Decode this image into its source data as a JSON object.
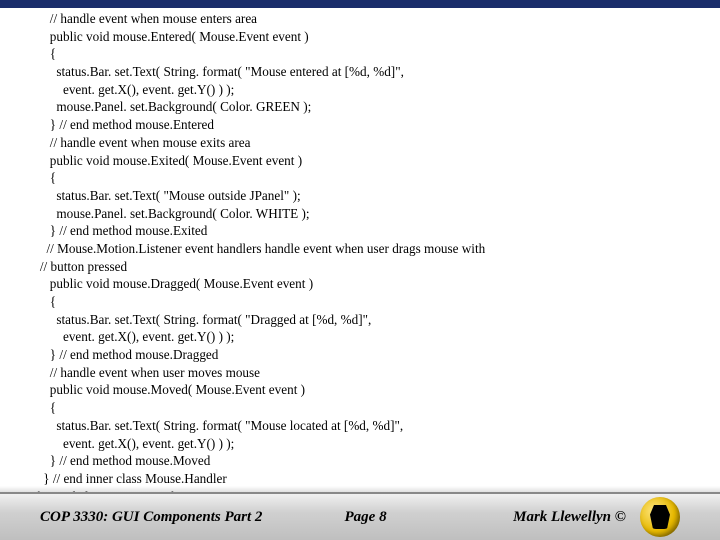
{
  "code_lines": [
    "      // handle event when mouse enters area",
    "      public void mouse.Entered( Mouse.Event event )",
    "      {",
    "        status.Bar. set.Text( String. format( \"Mouse entered at [%d, %d]\",",
    "          event. get.X(), event. get.Y() ) );",
    "        mouse.Panel. set.Background( Color. GREEN );",
    "      } // end method mouse.Entered",
    "      // handle event when mouse exits area",
    "      public void mouse.Exited( Mouse.Event event )",
    "      {",
    "        status.Bar. set.Text( \"Mouse outside JPanel\" );",
    "        mouse.Panel. set.Background( Color. WHITE );",
    "      } // end method mouse.Exited",
    "     // Mouse.Motion.Listener event handlers handle event when user drags mouse with",
    "   // button pressed",
    "      public void mouse.Dragged( Mouse.Event event )",
    "      {",
    "        status.Bar. set.Text( String. format( \"Dragged at [%d, %d]\",",
    "          event. get.X(), event. get.Y() ) );",
    "      } // end method mouse.Dragged",
    "      // handle event when user moves mouse",
    "      public void mouse.Moved( Mouse.Event event )",
    "      {",
    "        status.Bar. set.Text( String. format( \"Mouse located at [%d, %d]\",",
    "          event. get.X(), event. get.Y() ) );",
    "      } // end method mouse.Moved",
    "    } // end inner class Mouse.Handler",
    "  } // end class Mouse.Tracker.Frame"
  ],
  "footer": {
    "course": "COP 3330: GUI Components Part 2",
    "page": "Page 8",
    "author": "Mark Llewellyn ©"
  }
}
